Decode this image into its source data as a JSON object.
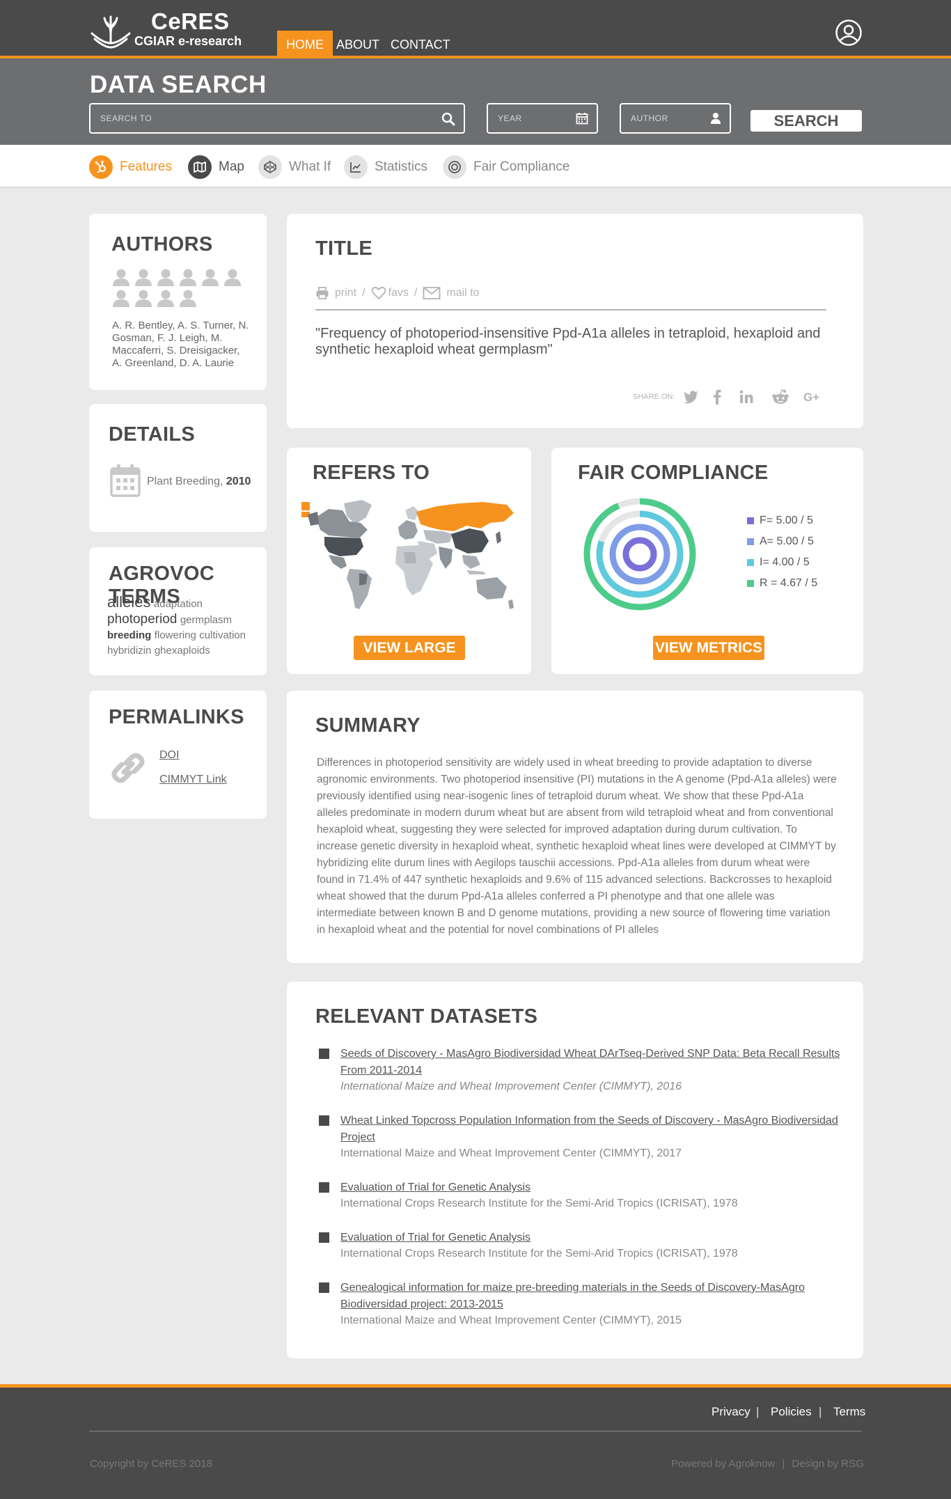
{
  "header": {
    "logo_name": "CeRES",
    "logo_sub": "CGIAR e-research",
    "nav": [
      "HOME",
      "ABOUT",
      "CONTACT"
    ],
    "user_icon": "user-circle-icon"
  },
  "search": {
    "title": "DATA SEARCH",
    "search_placeholder": "SEARCH TO",
    "year_placeholder": "YEAR",
    "author_placeholder": "AUTHOR",
    "button": "SEARCH"
  },
  "tabs": [
    "Features",
    "Map",
    "What If",
    "Statistics",
    "Fair Compliance"
  ],
  "authors": {
    "heading": "AUTHORS",
    "names": "A. R. Bentley, A. S. Turner, N. Gosman, F. J. Leigh, M. Maccaferri, S. Dreisigacker, A. Greenland, D. A. Laurie",
    "avatar_count": 10
  },
  "details": {
    "heading": "DETAILS",
    "text": "Plant Breeding,",
    "year": "2010"
  },
  "agrovoc": {
    "heading": "AGROVOC TERMS",
    "terms": [
      "alleles",
      "adaptation",
      "photoperiod",
      "germplasm",
      "breeding",
      "flowering",
      "cultivation",
      "hybridizin",
      "ghexaploids"
    ]
  },
  "permalinks": {
    "heading": "PERMALINKS",
    "links": [
      "DOI",
      "CIMMYT Link"
    ]
  },
  "title_card": {
    "heading": "TITLE",
    "actions": [
      "print",
      "favs",
      "mail to"
    ],
    "separator": "/",
    "text": "\"Frequency of photoperiod-insensitive Ppd-A1a alleles in tetraploid, hexaploid and synthetic hexaploid wheat germplasm\"",
    "share_label": "SHARE ON:"
  },
  "refers_to": {
    "heading": "REFERS TO",
    "button": "VIEW LARGE"
  },
  "fair": {
    "heading": "FAIR COMPLIANCE",
    "legend": [
      "F= 5.00 / 5",
      "A= 5.00 / 5",
      "I= 4.00 / 5",
      "R = 4.67 / 5"
    ],
    "values": [
      5.0,
      5.0,
      4.0,
      4.67
    ],
    "max": 5,
    "colors": [
      "#7b6fd9",
      "#7f9de6",
      "#5fc9de",
      "#4dcb8a"
    ],
    "button": "VIEW METRICS"
  },
  "summary": {
    "heading": "SUMMARY",
    "text": "Differences in photoperiod sensitivity are widely used in wheat breeding to provide adaptation to diverse agronomic environments. Two photoperiod insensitive (PI) mutations in the A genome (Ppd-A1a alleles) were previously identified using near-isogenic lines of tetraploid durum wheat. We show that these Ppd-A1a alleles predominate in modern durum wheat but are absent from wild tetraploid wheat and from conventional hexaploid wheat, suggesting they were selected for improved adaptation during durum cultivation. To increase genetic diversity in hexaploid wheat, synthetic hexaploid wheat lines were developed at CIMMYT by hybridizing elite durum lines with Aegilops tauschii accessions. Ppd-A1a alleles from durum wheat were found in 71.4% of 447 synthetic hexaploids and 9.6% of 115 advanced selections. Backcrosses to hexaploid wheat showed that the durum Ppd-A1a alleles conferred a PI phenotype and that one allele was intermediate between known B and D genome mutations, providing a new source of flowering time variation in hexaploid wheat and the potential for novel combinations of PI alleles"
  },
  "datasets": {
    "heading": "RELEVANT DATASETS",
    "items": [
      {
        "title": "Seeds of Discovery - MasAgro Biodiversidad Wheat DArTseq-Derived SNP Data: Beta Recall Results From 2011-2014",
        "source": "International Maize and Wheat Improvement Center (CIMMYT), 2016"
      },
      {
        "title": "Wheat Linked Topcross Population Information from the Seeds of Discovery - MasAgro Biodiversidad Project",
        "source": "International Maize and Wheat Improvement Center (CIMMYT), 2017"
      },
      {
        "title": "Evaluation of Trial for Genetic Analysis",
        "source": "International Crops Research Institute for the Semi-Arid Tropics (ICRISAT), 1978"
      },
      {
        "title": "Evaluation of Trial for Genetic Analysis",
        "source": "International Crops Research Institute for the Semi-Arid Tropics (ICRISAT), 1978"
      },
      {
        "title": "Genealogical information for maize pre-breeding materials in the Seeds of Discovery-MasAgro Biodiversidad project: 2013-2015",
        "source": "International Maize and Wheat Improvement Center (CIMMYT), 2015"
      }
    ]
  },
  "footer": {
    "links": [
      "Privacy",
      "Policies",
      "Terms"
    ],
    "divider": "|",
    "copyright": "Copyright by CeRES 2018",
    "powered": "Powered by Agroknow",
    "design": "Design by RSG"
  },
  "colors": {
    "accent": "#f6931e",
    "dark": "#4a4a4a",
    "band": "#6d6e70"
  }
}
